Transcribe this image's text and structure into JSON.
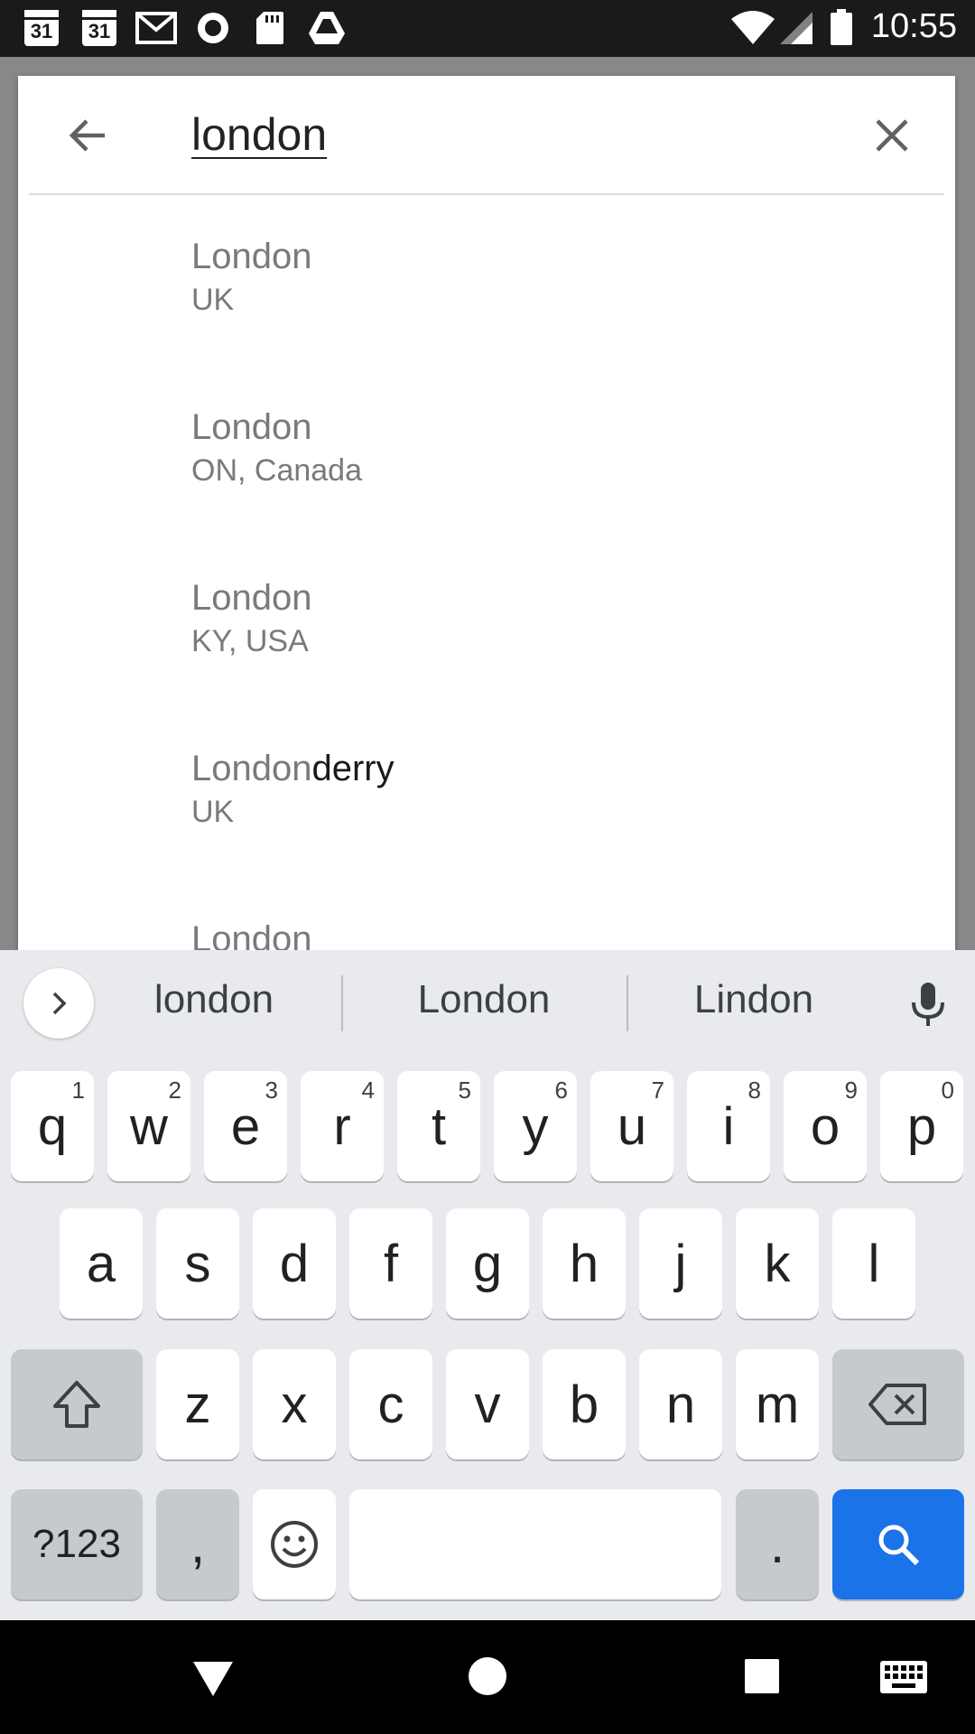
{
  "status_bar": {
    "time": "10:55",
    "left_icons": [
      {
        "icon": "calendar-icon",
        "label": "31"
      },
      {
        "icon": "calendar-icon",
        "label": "31"
      },
      {
        "icon": "gmail-icon"
      },
      {
        "icon": "record-icon"
      },
      {
        "icon": "sd-card-icon"
      },
      {
        "icon": "drive-icon"
      }
    ],
    "right_icons": [
      "wifi-icon",
      "signal-icon",
      "battery-icon"
    ]
  },
  "search": {
    "query": "london"
  },
  "results": [
    {
      "match": "London",
      "rest": "",
      "region": "UK"
    },
    {
      "match": "London",
      "rest": "",
      "region": "ON, Canada"
    },
    {
      "match": "London",
      "rest": "",
      "region": "KY, USA"
    },
    {
      "match": "London",
      "rest": "derry",
      "region": "UK"
    },
    {
      "match": "London",
      "rest": "",
      "region": ""
    }
  ],
  "keyboard": {
    "suggestions": [
      "london",
      "London",
      "Lindon"
    ],
    "row1": [
      {
        "key": "q",
        "hint": "1"
      },
      {
        "key": "w",
        "hint": "2"
      },
      {
        "key": "e",
        "hint": "3"
      },
      {
        "key": "r",
        "hint": "4"
      },
      {
        "key": "t",
        "hint": "5"
      },
      {
        "key": "y",
        "hint": "6"
      },
      {
        "key": "u",
        "hint": "7"
      },
      {
        "key": "i",
        "hint": "8"
      },
      {
        "key": "o",
        "hint": "9"
      },
      {
        "key": "p",
        "hint": "0"
      }
    ],
    "row2": [
      "a",
      "s",
      "d",
      "f",
      "g",
      "h",
      "j",
      "k",
      "l"
    ],
    "row3": [
      "z",
      "x",
      "c",
      "v",
      "b",
      "n",
      "m"
    ],
    "symbols_label": "?123",
    "comma_label": ",",
    "period_label": ".",
    "accent_color": "#1a73e8"
  }
}
